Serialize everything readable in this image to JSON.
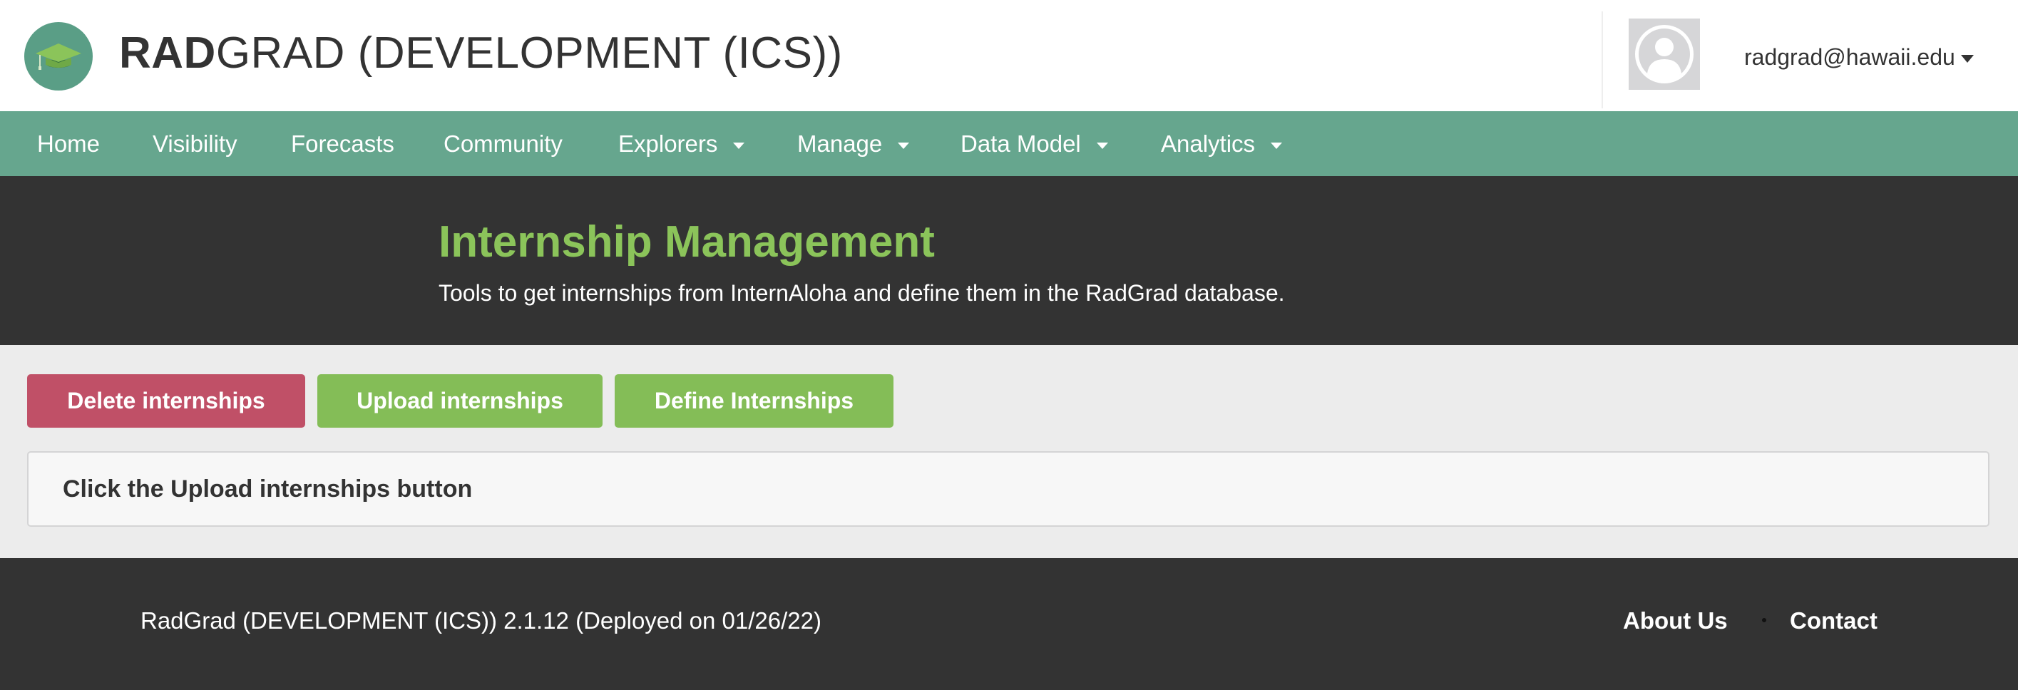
{
  "header": {
    "title_strong": "RAD",
    "title_rest": "GRAD (DEVELOPMENT (ICS))",
    "user_email": "radgrad@hawaii.edu",
    "logo_icon": "graduation-cap-logo-icon",
    "avatar_icon": "user-avatar-icon"
  },
  "nav": {
    "items": [
      {
        "label": "Home"
      },
      {
        "label": "Visibility"
      },
      {
        "label": "Forecasts"
      },
      {
        "label": "Community"
      },
      {
        "label": "Explorers"
      },
      {
        "label": "Manage"
      },
      {
        "label": "Data Model"
      },
      {
        "label": "Analytics"
      }
    ]
  },
  "banner": {
    "title": "Internship Management",
    "subtitle": "Tools to get internships from InternAloha and define them in the RadGrad database."
  },
  "actions": {
    "delete_label": "Delete internships",
    "upload_label": "Upload internships",
    "define_label": "Define Internships"
  },
  "message": {
    "text": "Click the Upload internships button"
  },
  "footer": {
    "version": "RadGrad (DEVELOPMENT (ICS)) 2.1.12 (Deployed on 01/26/22)",
    "about_label": "About Us",
    "contact_label": "Contact"
  },
  "colors": {
    "nav_bg": "#66a68e",
    "dark_bg": "#333333",
    "accent_green": "#8bc45a",
    "button_green": "#84bd57",
    "button_red": "#c05067"
  }
}
